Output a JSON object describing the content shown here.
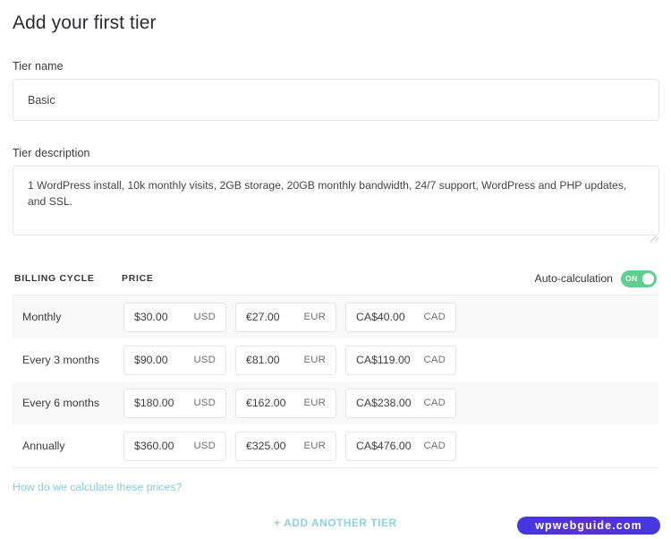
{
  "page": {
    "title": "Add your first tier"
  },
  "tier_name": {
    "label": "Tier name",
    "value": "Basic",
    "placeholder": "Tier name"
  },
  "tier_description": {
    "label": "Tier description",
    "value": "1 WordPress install, 10k monthly visits, 2GB storage, 20GB monthly bandwidth, 24/7 support, WordPress and PHP updates, and SSL.",
    "placeholder": "Tier description"
  },
  "pricing_table": {
    "headers": {
      "billing_cycle": "Billing cycle",
      "price": "Price"
    },
    "auto_calculation": {
      "label": "Auto-calculation",
      "state": "ON",
      "enabled": true,
      "color": "#5ecf8f"
    },
    "currencies": [
      "USD",
      "EUR",
      "CAD"
    ],
    "rows": [
      {
        "cycle": "Monthly",
        "usd": "$30.00",
        "eur": "€27.00",
        "cad": "CA$40.00"
      },
      {
        "cycle": "Every 3 months",
        "usd": "$90.00",
        "eur": "€81.00",
        "cad": "CA$119.00"
      },
      {
        "cycle": "Every 6 months",
        "usd": "$180.00",
        "eur": "€162.00",
        "cad": "CA$238.00"
      },
      {
        "cycle": "Annually",
        "usd": "$360.00",
        "eur": "€325.00",
        "cad": "CA$476.00"
      }
    ]
  },
  "footer": {
    "helper_link": "How do we calculate these prices?",
    "add_tier_label": "+ Add another tier",
    "link_color": "#89cbe4"
  },
  "watermark": {
    "text": "wpwebguide.com",
    "color": "#4b33dc"
  }
}
